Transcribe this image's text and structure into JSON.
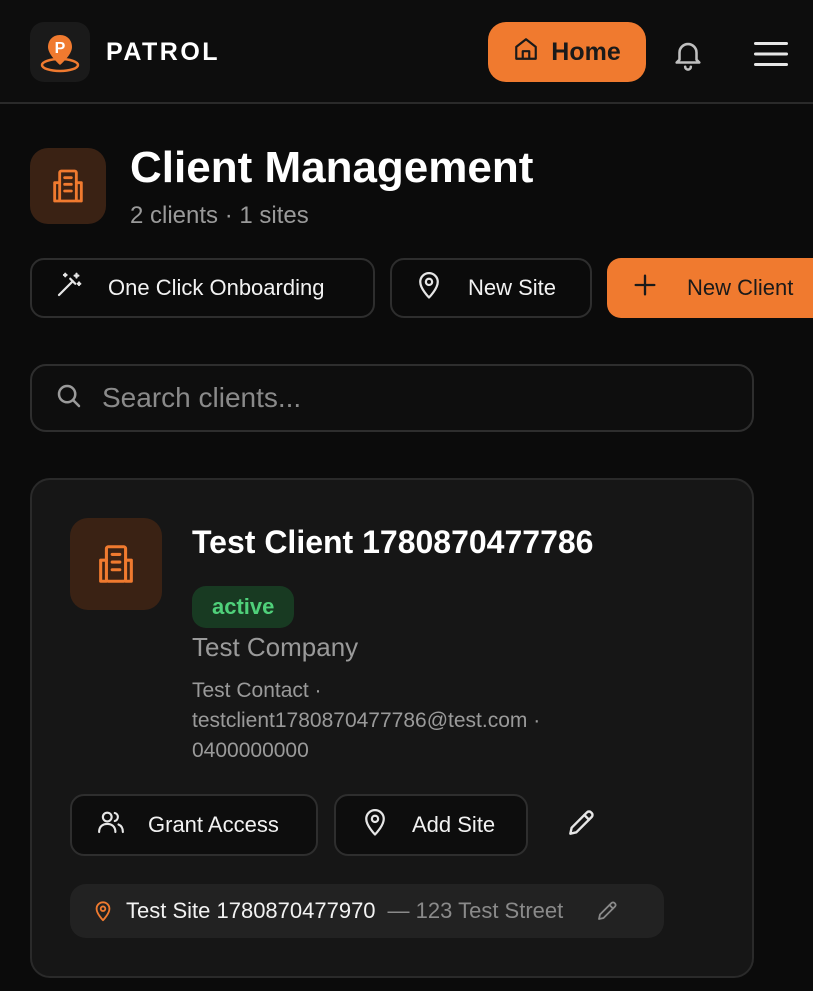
{
  "header": {
    "brand": "PATROL",
    "home_label": "Home",
    "icons": [
      "logo-icon",
      "home-icon",
      "bell-icon",
      "menu-icon"
    ]
  },
  "page": {
    "title": "Client Management",
    "subtitle": "2 clients · 1 sites",
    "icon": "building-icon"
  },
  "actions": {
    "onboarding_label": "One Click Onboarding",
    "new_site_label": "New Site",
    "new_client_label": "New Client"
  },
  "search": {
    "placeholder": "Search clients..."
  },
  "clients": [
    {
      "name": "Test Client 1780870477786",
      "status": "active",
      "company": "Test Company",
      "contact_line1": "Test Contact ·",
      "contact_line2": "testclient1780870477786@test.com ·",
      "contact_line3": "0400000000",
      "grant_access_label": "Grant Access",
      "add_site_label": "Add Site",
      "sites": [
        {
          "name": "Test Site 1780870477970",
          "address": "— 123 Test Street"
        }
      ]
    }
  ],
  "colors": {
    "accent": "#f07a2f",
    "background": "#0b0b0b",
    "card": "#161616",
    "status_active_bg": "#183a22",
    "status_active_text": "#4fd07a"
  }
}
